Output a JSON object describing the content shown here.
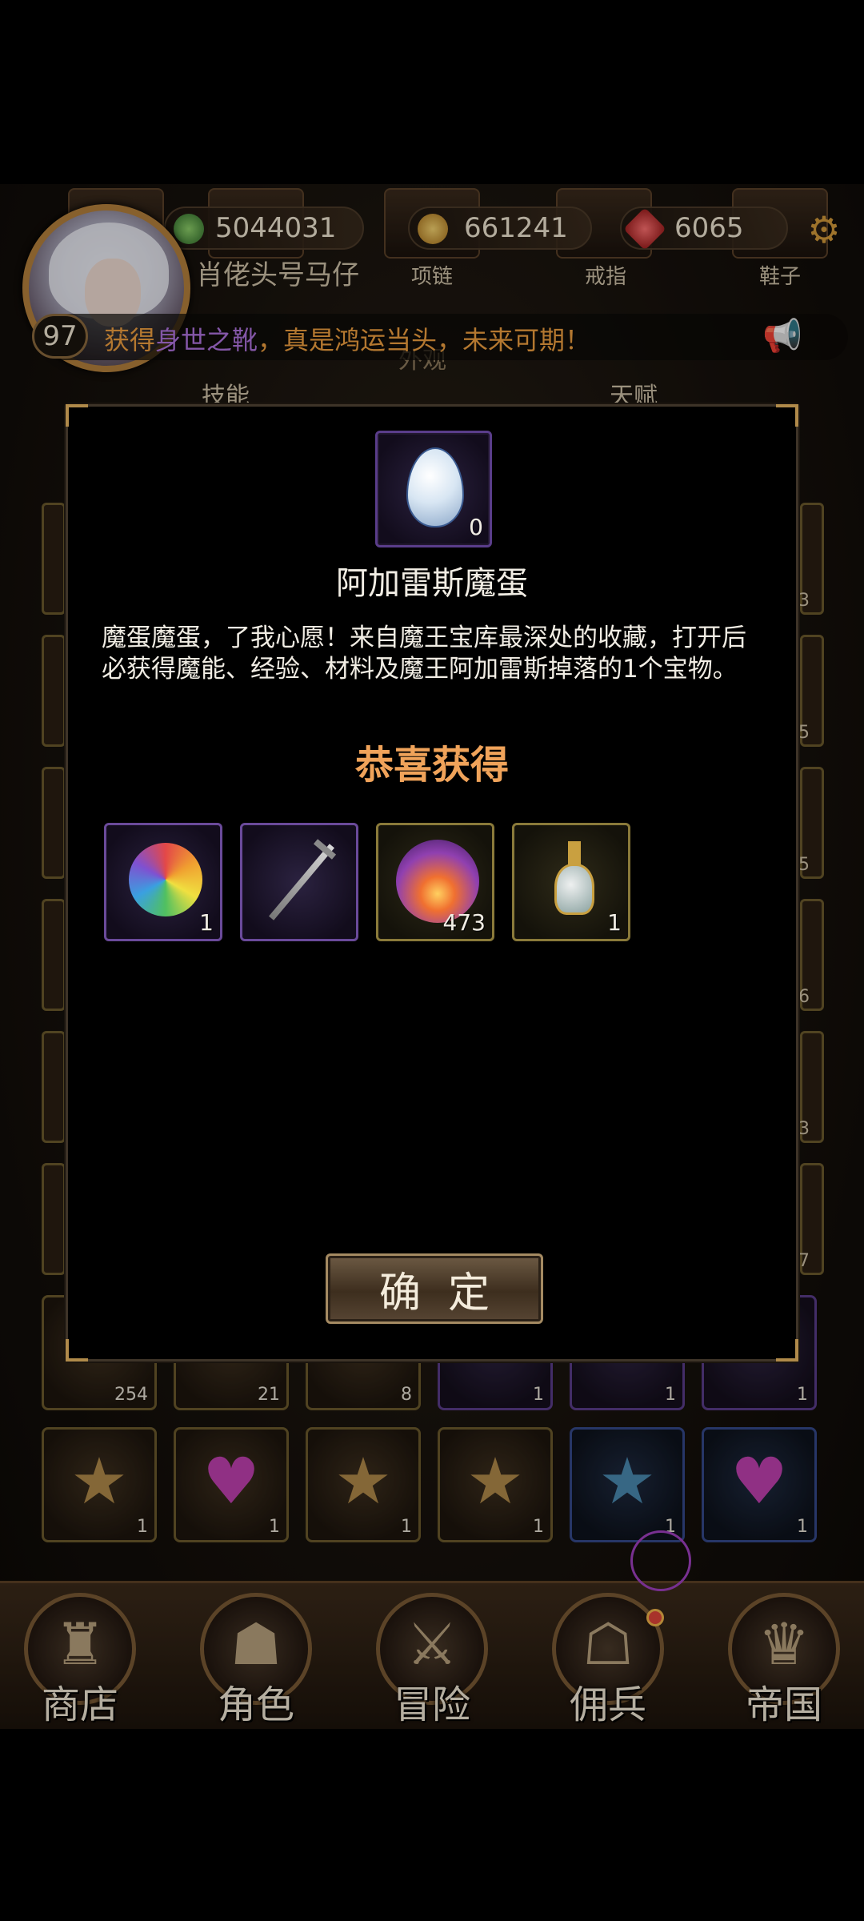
{
  "player": {
    "name": "肖佬头号马仔",
    "level": "97"
  },
  "currencies": {
    "power": "5044031",
    "gold": "661241",
    "gems": "6065"
  },
  "equipment_labels": [
    "项链",
    "戒指",
    "鞋子"
  ],
  "tabs": [
    "技能",
    "外观",
    "天赋"
  ],
  "marquee": {
    "prefix": "获得",
    "highlight": "身世之靴",
    "suffix": "，真是鸿运当头，未来可期！"
  },
  "inventory": {
    "row7_counts": [
      "254",
      "21",
      "8",
      "1",
      "1",
      "1"
    ],
    "row8_counts": [
      "1",
      "1",
      "1",
      "1",
      "1",
      "1"
    ],
    "side_counts": [
      "3",
      "5",
      "5",
      "6",
      "3",
      "7"
    ]
  },
  "dialog": {
    "item_count": "0",
    "item_title": "阿加雷斯魔蛋",
    "item_description": "魔蛋魔蛋，了我心愿！来自魔王宝库最深处的收藏，打开后必获得魔能、经验、材料及魔王阿加雷斯掉落的1个宝物。",
    "congrats": "恭喜获得",
    "rewards": [
      {
        "icon": "rainbow-orb-icon",
        "count": "1"
      },
      {
        "icon": "sword-icon",
        "count": ""
      },
      {
        "icon": "fire-orb-icon",
        "count": "473"
      },
      {
        "icon": "potion-icon",
        "count": "1"
      }
    ],
    "confirm_label": "确定"
  },
  "nav": {
    "items": [
      "商店",
      "角色",
      "冒险",
      "佣兵",
      "帝国"
    ]
  },
  "colors": {
    "accent_orange": "#f0a35a",
    "highlight_purple": "#b074e0",
    "frame_gold": "#b08a4a"
  }
}
